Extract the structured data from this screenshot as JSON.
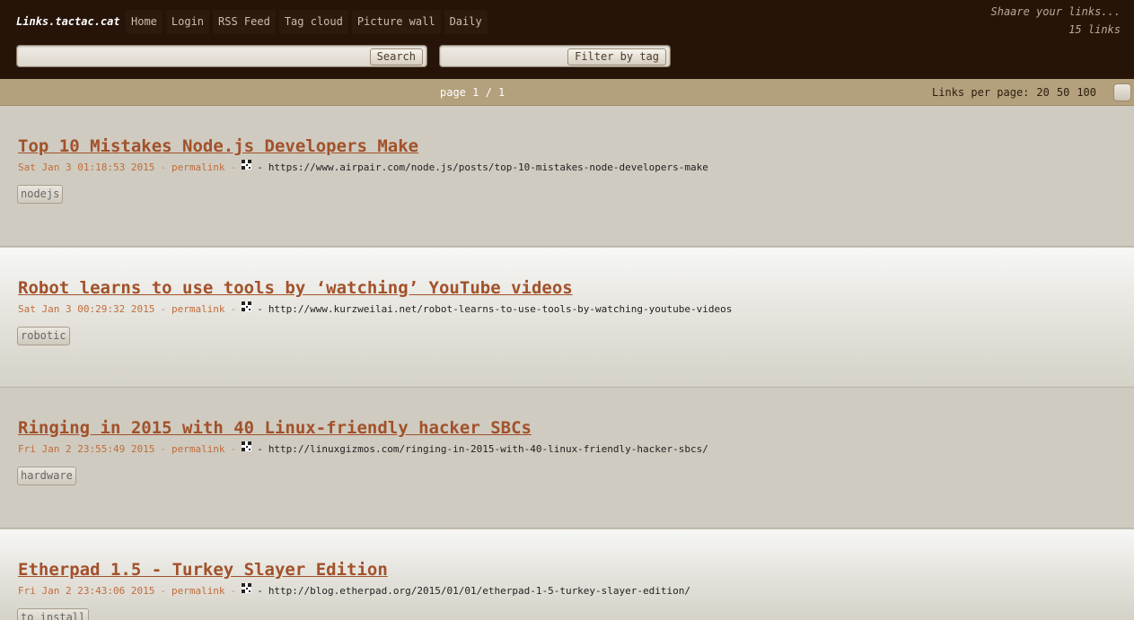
{
  "header": {
    "brand": "Links.tactac.cat",
    "menu": [
      "Home",
      "Login",
      "RSS Feed",
      "Tag cloud",
      "Picture wall",
      "Daily"
    ],
    "tagline": "Shaare your links...",
    "count": "15 links",
    "search_button": "Search",
    "filter_button": "Filter by tag"
  },
  "paging": {
    "page_info": "page 1 / 1",
    "per_page_label": "Links per page:",
    "per_page_options": [
      "20",
      "50",
      "100"
    ]
  },
  "links": [
    {
      "title": "Top 10 Mistakes Node.js Developers Make",
      "date": "Sat Jan 3 01:18:53 2015",
      "permalink": "permalink",
      "url": "https://www.airpair.com/node.js/posts/top-10-mistakes-node-developers-make",
      "tag": "nodejs"
    },
    {
      "title": "Robot learns to use tools by ‘watching’ YouTube videos",
      "date": "Sat Jan 3 00:29:32 2015",
      "permalink": "permalink",
      "url": "http://www.kurzweilai.net/robot-learns-to-use-tools-by-watching-youtube-videos",
      "tag": "robotic"
    },
    {
      "title": "Ringing in 2015 with 40 Linux-friendly hacker SBCs",
      "date": "Fri Jan 2 23:55:49 2015",
      "permalink": "permalink",
      "url": "http://linuxgizmos.com/ringing-in-2015-with-40-linux-friendly-hacker-sbcs/",
      "tag": "hardware"
    },
    {
      "title": "Etherpad 1.5 - Turkey Slayer Edition",
      "date": "Fri Jan 2 23:43:06 2015",
      "permalink": "permalink",
      "url": "http://blog.etherpad.org/2015/01/01/etherpad-1-5-turkey-slayer-edition/",
      "tag": "to_install"
    }
  ],
  "colors": {
    "header_bg": "#261409",
    "paging_bg": "#b4a07c",
    "title_link": "#a2512a",
    "meta_text": "#c26c3a"
  },
  "icons": {
    "qrcode": "qrcode-icon"
  }
}
